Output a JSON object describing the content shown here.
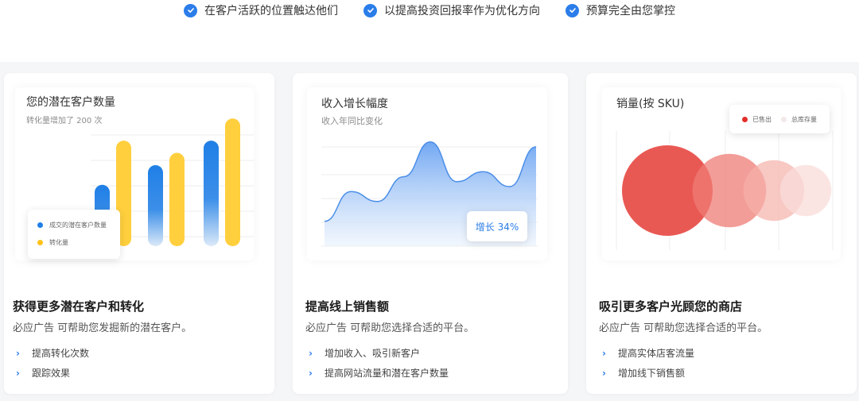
{
  "benefits": [
    {
      "label": "在客户活跃的位置触达他们",
      "icon": "check-circle-icon"
    },
    {
      "label": "以提高投资回报率作为优化方向",
      "icon": "check-circle-icon"
    },
    {
      "label": "预算完全由您掌控",
      "icon": "check-circle-icon"
    }
  ],
  "colors": {
    "accent": "#2b7de9",
    "yellow": "#ffcf3d",
    "red": "#e8504b",
    "light_red": "#f5bcb8"
  },
  "cards": [
    {
      "chart_title": "您的潜在客户数量",
      "chart_subtitle": "转化量增加了 200 次",
      "legend": [
        "成交的潜在客户数量",
        "转化量"
      ],
      "title": "获得更多潜在客户和转化",
      "desc": "必应广告 可帮助您发掘新的潜在客户。",
      "items": [
        "提高转化次数",
        "跟踪效果"
      ]
    },
    {
      "chart_title": "收入增长幅度",
      "chart_subtitle": "收入年同比变化",
      "badge": "增长 34%",
      "title": "提高线上销售额",
      "desc": "必应广告 可帮助您选择合适的平台。",
      "items": [
        "增加收入、吸引新客户",
        "提高网站流量和潜在客户数量"
      ]
    },
    {
      "chart_title": "销量(按 SKU)",
      "legend": [
        "已售出",
        "总库存量"
      ],
      "title": "吸引更多客户光顾您的商店",
      "desc": "必应广告 可帮助您选择合适的平台。",
      "items": [
        "提高实体店客流量",
        "增加线下销售额"
      ]
    }
  ],
  "chart_data": [
    {
      "type": "bar",
      "categories": [
        "1",
        "2",
        "3"
      ],
      "series": [
        {
          "name": "成交的潜在客户数量",
          "values": [
            25,
            33,
            43
          ]
        },
        {
          "name": "转化量",
          "values": [
            43,
            38,
            52
          ]
        }
      ],
      "ylim": [
        0,
        55
      ],
      "title": "您的潜在客户数量"
    },
    {
      "type": "area",
      "x": [
        0,
        1,
        2,
        3,
        4,
        5,
        6,
        7,
        8
      ],
      "values": [
        10,
        22,
        18,
        28,
        42,
        26,
        30,
        24,
        40
      ],
      "ylim": [
        0,
        48
      ],
      "title": "收入增长幅度"
    },
    {
      "type": "scatter",
      "values": [
        100,
        66,
        45,
        32
      ],
      "title": "销量(按 SKU)"
    }
  ]
}
